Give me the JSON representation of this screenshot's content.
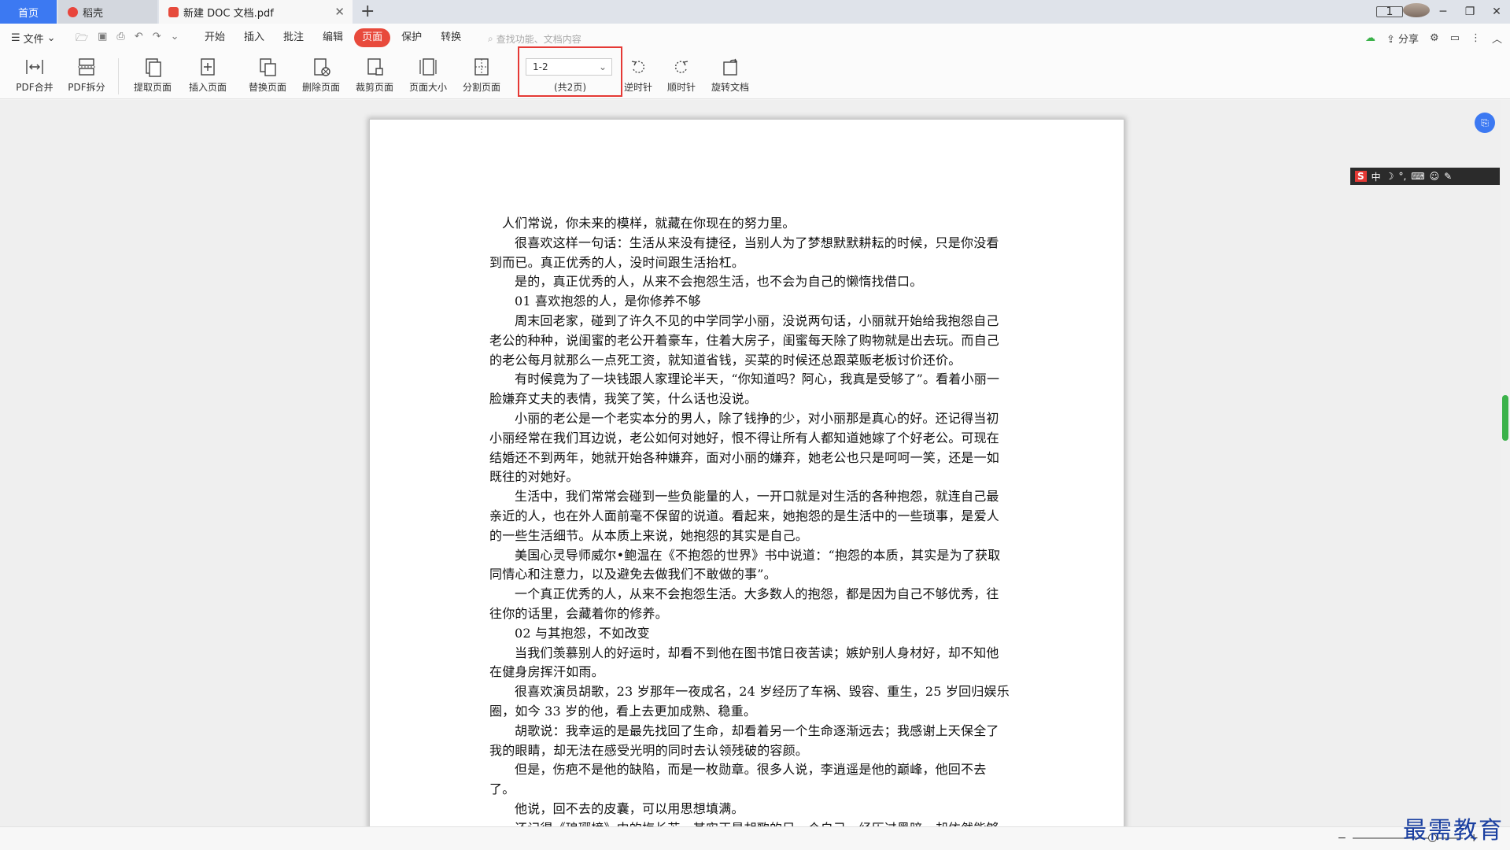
{
  "tabs": {
    "home": "首页",
    "draw": "稻壳",
    "doc": "新建 DOC 文档.pdf"
  },
  "menubar": {
    "file": "文件",
    "tabs": [
      "开始",
      "插入",
      "批注",
      "编辑",
      "页面",
      "保护",
      "转换"
    ],
    "active_tab": "页面",
    "search_placeholder": "查找功能、文档内容",
    "share": "分享"
  },
  "ribbon": {
    "buttons": [
      {
        "label": "PDF合并",
        "icon": "merge-icon"
      },
      {
        "label": "PDF拆分",
        "icon": "split-icon"
      },
      {
        "label": "提取页面",
        "icon": "extract-page-icon"
      },
      {
        "label": "插入页面",
        "icon": "insert-page-icon"
      },
      {
        "label": "替换页面",
        "icon": "replace-page-icon"
      },
      {
        "label": "删除页面",
        "icon": "delete-page-icon"
      },
      {
        "label": "裁剪页面",
        "icon": "crop-page-icon"
      },
      {
        "label": "页面大小",
        "icon": "page-size-icon"
      },
      {
        "label": "分割页面",
        "icon": "divide-page-icon"
      },
      {
        "label": "逆时针",
        "icon": "rotate-ccw-icon"
      },
      {
        "label": "顺时针",
        "icon": "rotate-cw-icon"
      },
      {
        "label": "旋转文档",
        "icon": "rotate-doc-icon"
      }
    ],
    "range_value": "1-2",
    "range_total": "(共2页)"
  },
  "document": {
    "paragraphs": [
      "人们常说，你未来的模样，就藏在你现在的努力里。",
      "很喜欢这样一句话：生活从来没有捷径，当别人为了梦想默默耕耘的时候，只是你没看到而已。真正优秀的人，没时间跟生活抬杠。",
      "是的，真正优秀的人，从来不会抱怨生活，也不会为自己的懒惰找借口。",
      "01 喜欢抱怨的人，是你修养不够",
      "周末回老家，碰到了许久不见的中学同学小丽，没说两句话，小丽就开始给我抱怨自己老公的种种，说闺蜜的老公开着豪车，住着大房子，闺蜜每天除了购物就是出去玩。而自己的老公每月就那么一点死工资，就知道省钱，买菜的时候还总跟菜贩老板讨价还价。",
      "有时候竟为了一块钱跟人家理论半天，“你知道吗？阿心，我真是受够了”。看着小丽一脸嫌弃丈夫的表情，我笑了笑，什么话也没说。",
      "小丽的老公是一个老实本分的男人，除了钱挣的少，对小丽那是真心的好。还记得当初小丽经常在我们耳边说，老公如何对她好，恨不得让所有人都知道她嫁了个好老公。可现在结婚还不到两年，她就开始各种嫌弃，面对小丽的嫌弃，她老公也只是呵呵一笑，还是一如既往的对她好。",
      "生活中，我们常常会碰到一些负能量的人，一开口就是对生活的各种抱怨，就连自己最亲近的人，也在外人面前毫不保留的说道。看起来，她抱怨的是生活中的一些琐事，是爱人的一些生活细节。从本质上来说，她抱怨的其实是自己。",
      "美国心灵导师威尔•鲍温在《不抱怨的世界》书中说道：“抱怨的本质，其实是为了获取同情心和注意力，以及避免去做我们不敢做的事”。",
      "一个真正优秀的人，从来不会抱怨生活。大多数人的抱怨，都是因为自己不够优秀，往往你的话里，会藏着你的修养。",
      "02 与其抱怨，不如改变",
      "当我们羡慕别人的好运时，却看不到他在图书馆日夜苦读；嫉妒别人身材好，却不知他在健身房挥汗如雨。",
      "很喜欢演员胡歌，23 岁那年一夜成名，24 岁经历了车祸、毁容、重生，25 岁回归娱乐圈，如今 33 岁的他，看上去更加成熟、稳重。",
      "胡歌说：我幸运的是最先找回了生命，却看着另一个生命逐渐远去；我感谢上天保全了我的眼睛，却无法在感受光明的同时去认领残破的容颜。",
      "但是，伤疤不是他的缺陷，而是一枚勋章。很多人说，李逍遥是他的巅峰，他回不去了。",
      "他说，回不去的皮囊，可以用思想填满。",
      "还记得《琅琊榜》中的梅长苏，其实正是胡歌的另一个自己，经历过黑暗，却依然能够"
    ]
  },
  "ime": {
    "label": "中"
  },
  "watermark": "最需教育"
}
